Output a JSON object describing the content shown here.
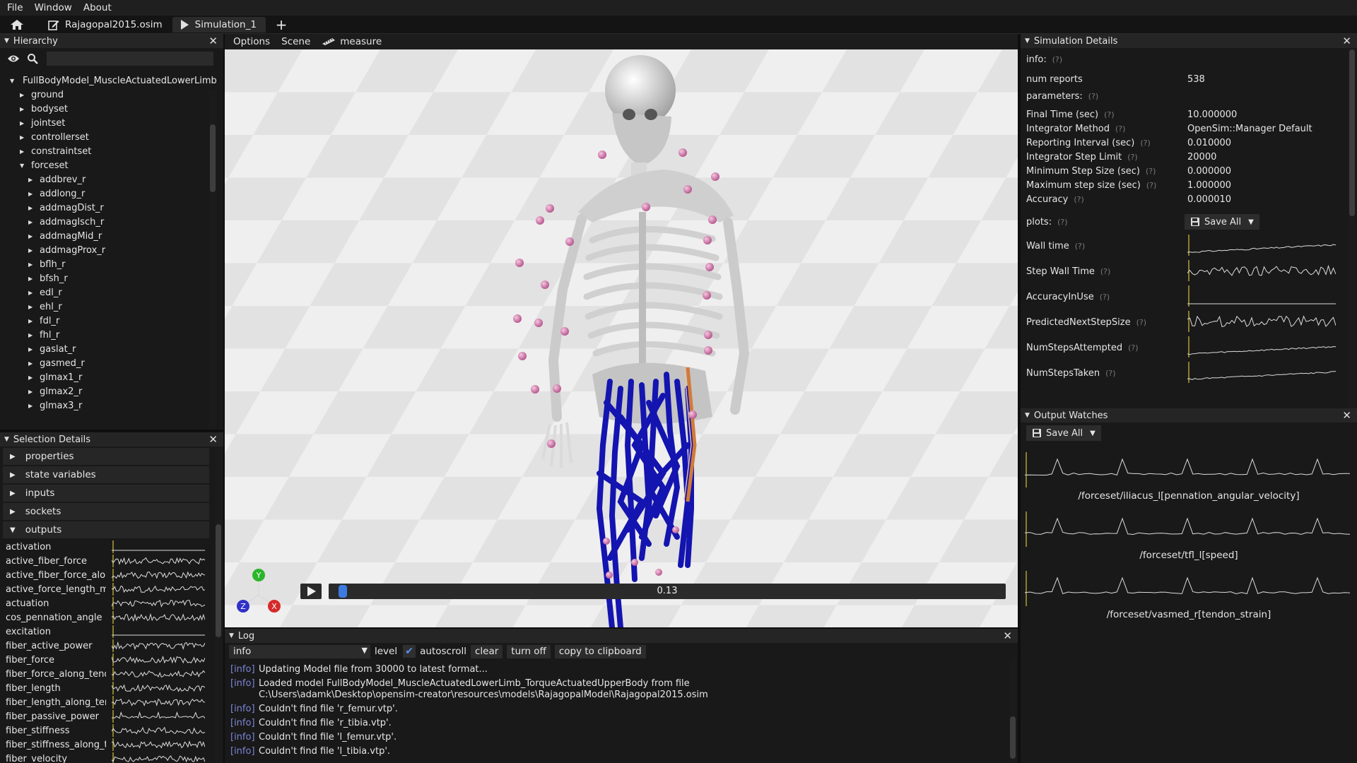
{
  "menu": {
    "file": "File",
    "window": "Window",
    "about": "About"
  },
  "tabs": {
    "model": "Rajagopal2015.osim",
    "simulation": "Simulation_1",
    "add": "+"
  },
  "hierarchy": {
    "title": "Hierarchy",
    "root": "FullBodyModel_MuscleActuatedLowerLimb",
    "items": [
      "ground",
      "bodyset",
      "jointset",
      "controllerset",
      "constraintset",
      "forceset"
    ],
    "forces": [
      "addbrev_r",
      "addlong_r",
      "addmagDist_r",
      "addmagIsch_r",
      "addmagMid_r",
      "addmagProx_r",
      "bflh_r",
      "bfsh_r",
      "edl_r",
      "ehl_r",
      "fdl_r",
      "fhl_r",
      "gaslat_r",
      "gasmed_r",
      "glmax1_r",
      "glmax2_r",
      "glmax3_r"
    ]
  },
  "selection": {
    "title": "Selection Details",
    "sections": [
      "properties",
      "state variables",
      "inputs",
      "sockets",
      "outputs"
    ],
    "outputs": [
      "activation",
      "active_fiber_force",
      "active_fiber_force_along_tendon",
      "active_force_length_multiplier",
      "actuation",
      "cos_pennation_angle",
      "excitation",
      "fiber_active_power",
      "fiber_force",
      "fiber_force_along_tendon",
      "fiber_length",
      "fiber_length_along_tendon",
      "fiber_passive_power",
      "fiber_stiffness",
      "fiber_stiffness_along_tendon",
      "fiber_velocity"
    ]
  },
  "viewport": {
    "options": "Options",
    "scene": "Scene",
    "measure": "measure",
    "time_value": "0.13",
    "axes": {
      "x": "X",
      "y": "Y",
      "z": "Z"
    }
  },
  "log": {
    "title": "Log",
    "level_value": "info",
    "level_label": "level",
    "autoscroll": "autoscroll",
    "clear": "clear",
    "turn_off": "turn off",
    "copy": "copy to clipboard",
    "lines": [
      {
        "lv": "[info]",
        "msg": "Updating Model file from 30000 to latest format..."
      },
      {
        "lv": "[info]",
        "msg": "Loaded model FullBodyModel_MuscleActuatedLowerLimb_TorqueActuatedUpperBody from file",
        "msg2": "C:\\Users\\adamk\\Desktop\\opensim-creator\\resources\\models\\RajagopalModel\\Rajagopal2015.osim"
      },
      {
        "lv": "[info]",
        "msg": "Couldn't find file 'r_femur.vtp'."
      },
      {
        "lv": "[info]",
        "msg": "Couldn't find file 'r_tibia.vtp'."
      },
      {
        "lv": "[info]",
        "msg": "Couldn't find file 'l_femur.vtp'."
      },
      {
        "lv": "[info]",
        "msg": "Couldn't find file 'l_tibia.vtp'."
      }
    ]
  },
  "sim": {
    "title": "Simulation Details",
    "info": "info:",
    "help": "(?)",
    "num_reports_label": "num reports",
    "num_reports": "538",
    "parameters": "parameters:",
    "params": [
      {
        "k": "Final Time (sec)",
        "v": "10.000000"
      },
      {
        "k": "Integrator Method",
        "v": "OpenSim::Manager Default"
      },
      {
        "k": "Reporting Interval (sec)",
        "v": "0.010000"
      },
      {
        "k": "Integrator Step Limit",
        "v": "20000"
      },
      {
        "k": "Minimum Step Size (sec)",
        "v": "0.000000"
      },
      {
        "k": "Maximum step size (sec)",
        "v": "1.000000"
      },
      {
        "k": "Accuracy",
        "v": "0.000010"
      }
    ],
    "plots": "plots:",
    "save_all": "Save All",
    "plot_names": [
      "Wall time",
      "Step Wall Time",
      "AccuracyInUse",
      "PredictedNextStepSize",
      "NumStepsAttempted",
      "NumStepsTaken"
    ]
  },
  "watches": {
    "title": "Output Watches",
    "save_all": "Save All",
    "items": [
      "/forceset/iliacus_l[pennation_angular_velocity]",
      "/forceset/tfl_l[speed]",
      "/forceset/vasmed_r[tendon_strain]"
    ]
  },
  "colors": {
    "accent": "#3d7ae0",
    "muscle": "#1010b4",
    "marker": "#d77fb0",
    "log_level": "#7d86d8"
  }
}
